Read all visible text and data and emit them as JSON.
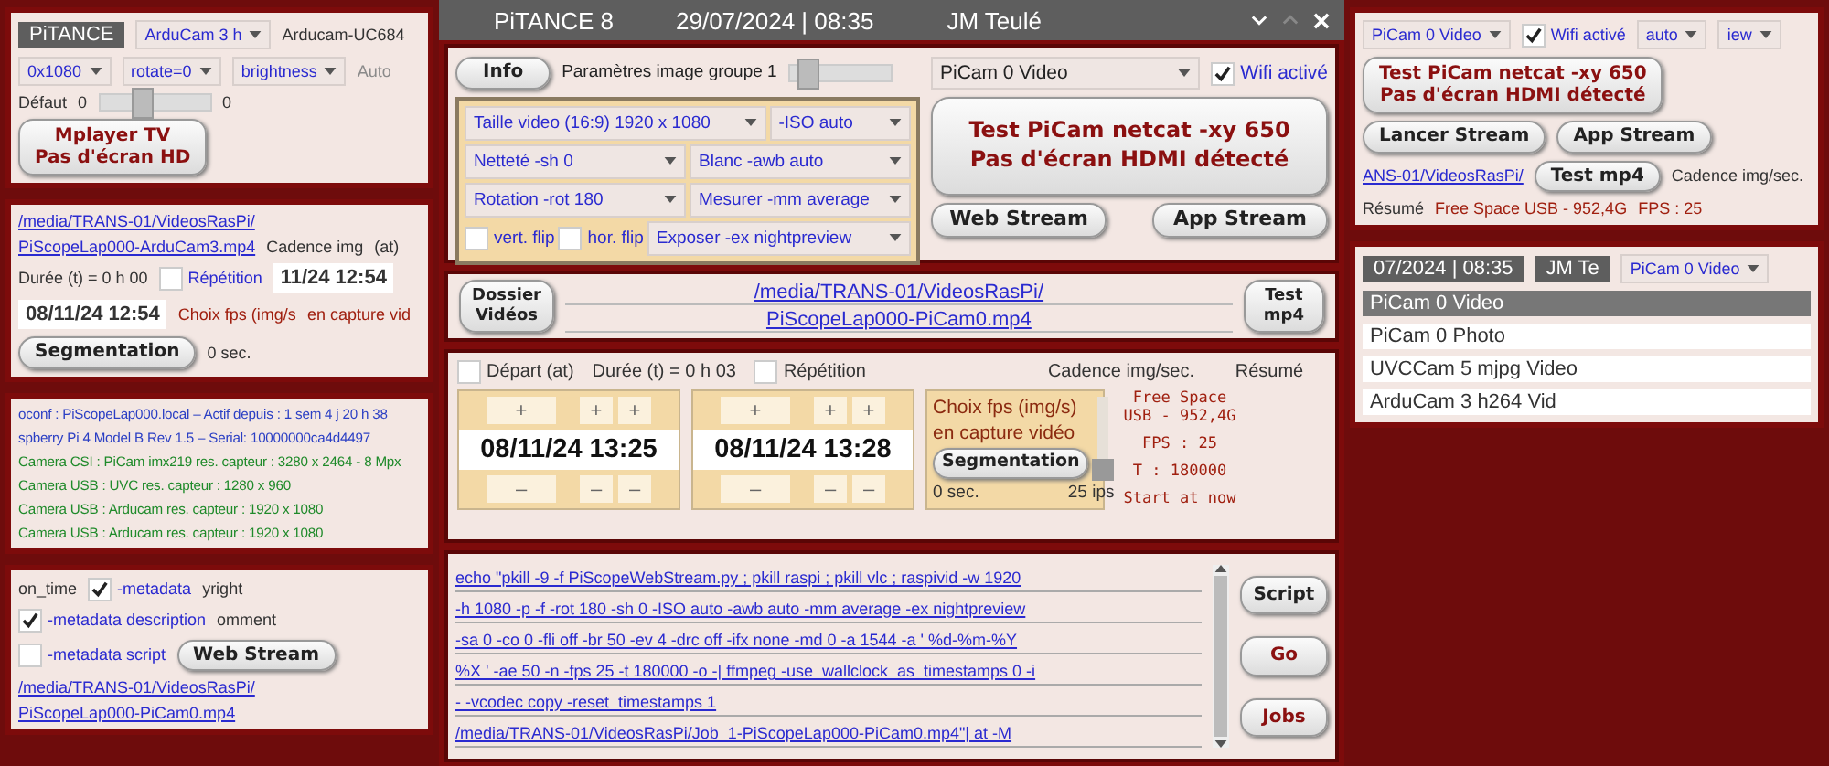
{
  "window": {
    "title": "PiTANCE 8",
    "date": "29/07/2024 | 08:35",
    "author": "JM Teulé"
  },
  "camera_panel": {
    "info_button": "Info",
    "group_label": "Paramètres image groupe 1",
    "group_slider": {
      "level": 0.1
    },
    "camera_select": "PiCam 0 Video",
    "wifi": {
      "label": "Wifi activé",
      "checked": true
    },
    "settings_rows": [
      {
        "cells": [
          {
            "kind": "select",
            "text": "Taille video   (16:9) 1920 x 1080"
          },
          {
            "kind": "select",
            "text": "-ISO auto"
          }
        ]
      },
      {
        "cells": [
          {
            "kind": "select",
            "text": "Netteté -sh 0"
          },
          {
            "kind": "select",
            "text": "Blanc -awb auto"
          }
        ]
      },
      {
        "cells": [
          {
            "kind": "select",
            "text": "Rotation -rot 180"
          },
          {
            "kind": "select",
            "text": "Mesurer -mm average"
          }
        ]
      },
      {
        "cells": [
          {
            "kind": "check",
            "text": "vert. flip",
            "checked": false
          },
          {
            "kind": "check",
            "text": "hor. flip",
            "checked": false
          },
          {
            "kind": "select",
            "text": "Exposer -ex nightpreview"
          }
        ]
      }
    ],
    "status_button": [
      "Test PiCam netcat -xy 650",
      "Pas d'écran HDMI détecté"
    ],
    "stream_buttons": [
      "Web Stream",
      "App Stream"
    ]
  },
  "folder_panel": {
    "folder_button": [
      "Dossier",
      "Vidéos"
    ],
    "path": [
      "/media/TRANS-01/VideosRasPi/",
      "PiScopeLap000-PiCam0.mp4"
    ],
    "test_button": [
      "Test",
      "mp4"
    ]
  },
  "schedule_panel": {
    "start": {
      "label": "Départ (at)",
      "checked": false
    },
    "duration": "Durée (t) = 0 h 03",
    "repeat": {
      "label": "Répétition",
      "checked": false
    },
    "rate_label": "Cadence img/sec.",
    "summary_label": "Résumé",
    "spinners": [
      {
        "plus": [
          "+",
          "+",
          "+"
        ],
        "time": "08/11/24 13:25",
        "minus": [
          "–",
          "–",
          "–"
        ]
      },
      {
        "plus": [
          "+",
          "+",
          "+"
        ],
        "time": "08/11/24 13:28",
        "minus": [
          "–",
          "–",
          "–"
        ]
      }
    ],
    "fps": {
      "lines": [
        "Choix fps (img/s)",
        "en capture vidéo"
      ],
      "button": "Segmentation",
      "slider": {
        "level": 0.25
      },
      "min_label": "0 sec.",
      "max_label": "25 ips"
    },
    "summary": [
      "Free Space USB - 952,4G",
      "FPS : 25",
      "T :  180000",
      "Start at now"
    ]
  },
  "script_panel": {
    "lines": [
      "echo \"pkill -9 -f PiScopeWebStream.py ; pkill raspi ; pkill vlc ; raspivid -w 1920",
      "-h 1080  -p -f -rot 180 -sh 0 -ISO auto -awb auto -mm average -ex nightpreview",
      "-sa 0 -co 0 -fli off -br 50 -ev 4 -drc off -ifx none -md 0 -a 1544 -a ' %d-%m-%Y",
      "%X ' -ae 50 -n -fps 25 -t 180000  -o -| ffmpeg -use_wallclock_as_timestamps 0 -i",
      "- -vcodec copy -reset_timestamps 1",
      "/media/TRANS-01/VideosRasPi/Job_1-PiScopeLap000-PiCam0.mp4\"| at -M"
    ],
    "buttons": [
      "Script",
      "Go",
      "Jobs"
    ]
  },
  "collage_left": [
    {
      "items": [
        {
          "kind": "title",
          "text": "PiTANCE"
        },
        {
          "kind": "select",
          "text": "ArduCam 3 h"
        },
        {
          "kind": "text",
          "text": "Arducam-UC684"
        },
        {
          "kind": "select",
          "text": "0x1080"
        },
        {
          "kind": "select",
          "text": "rotate=0"
        },
        {
          "kind": "select",
          "text": "brightness"
        },
        {
          "kind": "text",
          "text": "Auto",
          "disabled": true
        },
        {
          "kind": "text",
          "text": "Défaut"
        },
        {
          "kind": "text",
          "text": "0"
        },
        {
          "kind": "slider",
          "level": 0.35
        },
        {
          "kind": "text",
          "text": "0"
        },
        {
          "kind": "status",
          "lines": [
            "Mplayer TV",
            "Pas d'écran HD"
          ]
        }
      ]
    },
    {
      "items": [
        {
          "kind": "link",
          "text": "/media/TRANS-01/VideosRasPi/"
        },
        {
          "kind": "link",
          "text": "PiScopeLap000-ArduCam3.mp4"
        },
        {
          "kind": "text",
          "text": "Cadence img"
        },
        {
          "kind": "text",
          "text": "(at)"
        },
        {
          "kind": "text",
          "text": "Durée (t) = 0 h 00"
        },
        {
          "kind": "check",
          "text": "Répétition",
          "checked": false
        },
        {
          "kind": "time",
          "text": "11/24 12:54"
        },
        {
          "kind": "time",
          "text": "08/11/24 12:54"
        },
        {
          "kind": "note",
          "text": "Choix fps (img/s"
        },
        {
          "kind": "note",
          "text": "en capture vid"
        },
        {
          "kind": "button",
          "text": "Segmentation"
        },
        {
          "kind": "text",
          "text": "0 sec."
        }
      ]
    },
    {
      "items": [
        {
          "kind": "info",
          "text": "oconf : PiScopeLap000.local – Actif depuis : 1 sem 4 j 20 h 38",
          "color": "#2b3fc4"
        },
        {
          "kind": "info",
          "text": "spberry Pi 4 Model B Rev 1.5 – Serial: 10000000ca4d4497",
          "color": "#2b3fc4"
        },
        {
          "kind": "info",
          "text": "Camera CSI : PiCam imx219   res. capteur : 3280 x 2464 - 8 Mpx",
          "color": "#1f8a2a"
        },
        {
          "kind": "info",
          "text": "Camera USB : UVC  res. capteur : 1280 x 960",
          "color": "#1f8a2a"
        },
        {
          "kind": "info",
          "text": "Camera USB : Arducam  res. capteur : 1920 x 1080",
          "color": "#1f8a2a"
        },
        {
          "kind": "info",
          "text": "Camera USB : Arducam  res. capteur : 1920 x 1080",
          "color": "#1f8a2a"
        }
      ]
    },
    {
      "items": [
        {
          "kind": "text",
          "text": "on_time"
        },
        {
          "kind": "check",
          "text": "-metadata",
          "checked": true
        },
        {
          "kind": "text",
          "text": "yright"
        },
        {
          "kind": "check",
          "text": "-metadata description",
          "checked": true
        },
        {
          "kind": "text",
          "text": "omment"
        },
        {
          "kind": "check",
          "text": "-metadata script",
          "checked": false
        },
        {
          "kind": "button",
          "text": "Web Stream"
        },
        {
          "kind": "link",
          "text": "/media/TRANS-01/VideosRasPi/"
        },
        {
          "kind": "link",
          "text": "PiScopeLap000-PiCam0.mp4"
        }
      ]
    }
  ],
  "collage_right": [
    {
      "items": [
        {
          "kind": "select",
          "text": "PiCam 0 Video"
        },
        {
          "kind": "check",
          "text": "Wifi activé",
          "checked": true
        },
        {
          "kind": "select",
          "text": "auto"
        },
        {
          "kind": "select",
          "text": "iew"
        },
        {
          "kind": "status",
          "lines": [
            "Test PiCam netcat -xy 650",
            "Pas d'écran HDMI détecté"
          ]
        },
        {
          "kind": "button",
          "text": "Lancer Stream"
        },
        {
          "kind": "button",
          "text": "App Stream"
        },
        {
          "kind": "link",
          "text": "ANS-01/VideosRasPi/"
        },
        {
          "kind": "button",
          "text": "Test mp4"
        },
        {
          "kind": "text",
          "text": "Cadence img/sec."
        },
        {
          "kind": "text",
          "text": "Résumé"
        },
        {
          "kind": "note",
          "text": "Free Space USB - 952,4G"
        },
        {
          "kind": "note",
          "text": "FPS : 25"
        }
      ]
    },
    {
      "items": [
        {
          "kind": "title",
          "text": "07/2024 | 08:35"
        },
        {
          "kind": "title",
          "text": "JM Te"
        },
        {
          "kind": "select",
          "text": "PiCam 0 Video"
        },
        {
          "kind": "option",
          "text": "PiCam 0 Video",
          "selected": true
        },
        {
          "kind": "option",
          "text": "PiCam 0 Photo",
          "selected": false
        },
        {
          "kind": "option",
          "text": "UVCCam 5 mjpg Video",
          "selected": false
        },
        {
          "kind": "option",
          "text": "ArduCam 3 h264 Vid",
          "selected": false
        }
      ]
    }
  ]
}
